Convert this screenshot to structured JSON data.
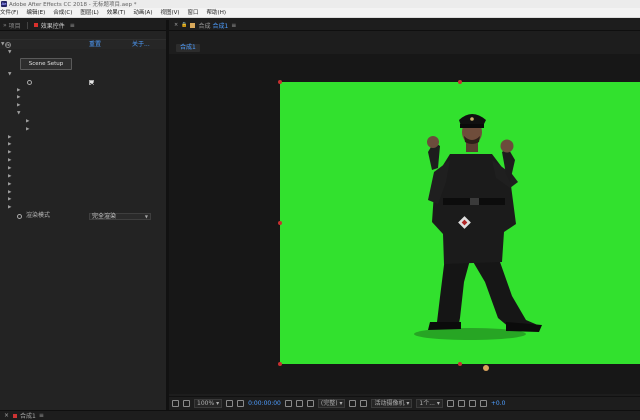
{
  "window": {
    "title": "Adobe After Effects CC 2018 - 无标题项目.aep *"
  },
  "menubar": {
    "items": [
      "文件(F)",
      "编辑(E)",
      "合成(C)",
      "图层(L)",
      "效果(T)",
      "动画(A)",
      "视图(V)",
      "窗口",
      "帮助(H)"
    ]
  },
  "left_panel": {
    "tab_project": "项目",
    "tab_effects_prefix": "效果控件",
    "tab_effects_name": "",
    "breadcrumb": "",
    "effect_name": "",
    "reset_label": "重置",
    "about_label": "关于...",
    "scene_setup_label": "Scene Setup",
    "rows": [
      {
        "name": "",
        "indent": 1,
        "arrow": "down"
      },
      {
        "name": "",
        "indent": 1,
        "arrow": "down"
      },
      {
        "name": "",
        "indent": 3,
        "arrow": "none",
        "checkbox": true
      },
      {
        "name": "",
        "indent": 2,
        "arrow": "right"
      },
      {
        "name": "",
        "indent": 2,
        "arrow": "right"
      },
      {
        "name": "",
        "indent": 2,
        "arrow": "right"
      },
      {
        "name": "",
        "indent": 2,
        "arrow": "down"
      },
      {
        "name": "",
        "indent": 3,
        "arrow": "right"
      },
      {
        "name": "",
        "indent": 3,
        "arrow": "right"
      },
      {
        "name": "",
        "indent": 1,
        "arrow": "right"
      },
      {
        "name": "",
        "indent": 1,
        "arrow": "right"
      },
      {
        "name": "",
        "indent": 1,
        "arrow": "right"
      },
      {
        "name": "",
        "indent": 1,
        "arrow": "right"
      },
      {
        "name": "",
        "indent": 1,
        "arrow": "right"
      },
      {
        "name": "",
        "indent": 1,
        "arrow": "right"
      },
      {
        "name": "",
        "indent": 1,
        "arrow": "right"
      },
      {
        "name": "",
        "indent": 1,
        "arrow": "right"
      },
      {
        "name": "",
        "indent": 1,
        "arrow": "right"
      },
      {
        "name": "",
        "indent": 1,
        "arrow": "right"
      }
    ],
    "render_mode_label": "渲染模式",
    "render_mode_value": "完全渲染"
  },
  "comp_panel": {
    "tab_prefix": "合成",
    "tab_name": "合成1",
    "subtab": "合成1",
    "toolbar": {
      "zoom": "100%",
      "timecode": "0:00:00:00",
      "resolution": "(完整)",
      "camera": "活动摄像机",
      "views": "1个...",
      "exposure": "+0.0"
    }
  },
  "timeline": {
    "tab": "合成1"
  },
  "colors": {
    "green_screen": "#32e12e",
    "accent_blue": "#4e9eff",
    "handle_red": "#c63030"
  }
}
